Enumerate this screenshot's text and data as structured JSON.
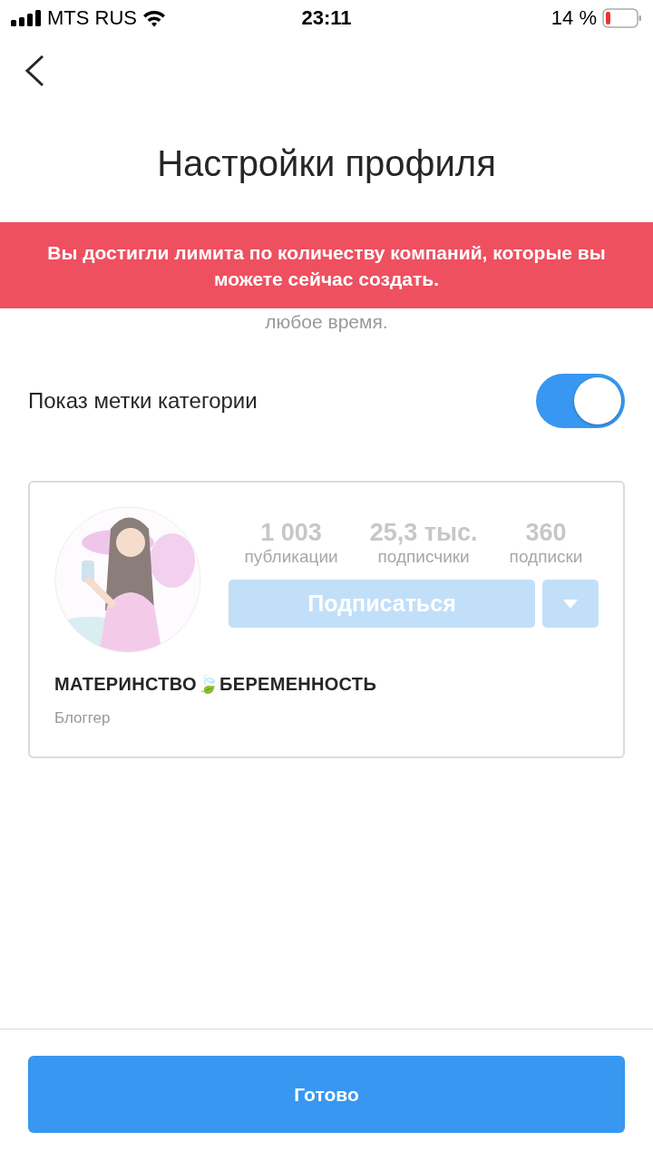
{
  "status_bar": {
    "carrier": "MTS RUS",
    "time": "23:11",
    "battery": "14 %"
  },
  "title": "Настройки профиля",
  "description_visible": "любое время.",
  "banner": {
    "text": "Вы достигли лимита по количеству компаний, которые вы можете сейчас создать."
  },
  "toggle": {
    "label": "Показ метки категории",
    "on": true
  },
  "preview": {
    "stats": [
      {
        "value": "1 003",
        "label": "публикации"
      },
      {
        "value": "25,3 тыс.",
        "label": "подписчики"
      },
      {
        "value": "360",
        "label": "подписки"
      }
    ],
    "follow_button": {
      "label": "Подписаться",
      "disabled": true
    },
    "name": "МАТЕРИНСТВО🍃БЕРЕМЕННОСТЬ",
    "category": "Блоггер"
  },
  "done_button": "Готово"
}
